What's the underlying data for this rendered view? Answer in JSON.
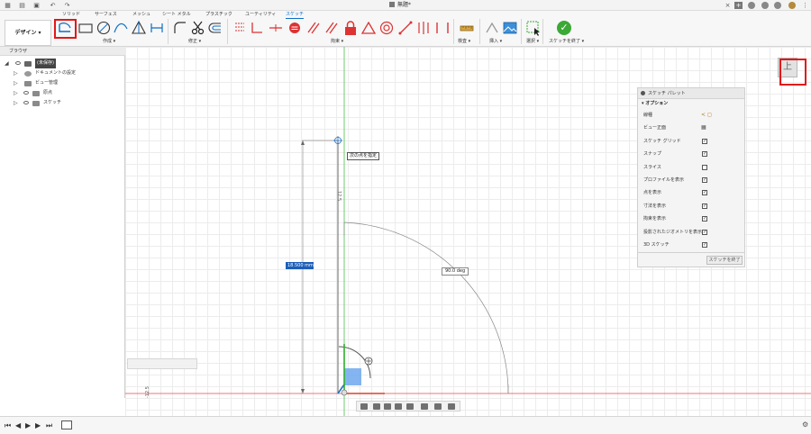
{
  "document": {
    "title": "無題*"
  },
  "ribbon": {
    "workspace": "デザイン ▾",
    "tabs": [
      "ソリッド",
      "サーフェス",
      "メッシュ",
      "シート メタル",
      "プラスチック",
      "ユーティリティ",
      "スケッチ"
    ],
    "active_tab": "スケッチ",
    "groups": {
      "create": "作成 ▾",
      "modify": "修正 ▾",
      "constraints": "拘束 ▾",
      "inspect": "検査 ▾",
      "insert": "挿入 ▾",
      "select": "選択 ▾",
      "finish": "スケッチを終了 ▾"
    }
  },
  "browser": {
    "title": "ブラウザ",
    "root": "(未保存)",
    "items": [
      "ドキュメントの設定",
      "ビュー管理",
      "原点",
      "スケッチ"
    ]
  },
  "canvas": {
    "tooltip": "次の点を指定",
    "length_input": "18.500 mm",
    "angle_label": "90.0 deg",
    "dim_side": "12.5",
    "dim_side_bottom": "-12.5",
    "viewcube_face": "上"
  },
  "palette": {
    "title": "スケッチ パレット",
    "options_header": "オプション",
    "rows": [
      {
        "label": "線種",
        "type": "linetype",
        "checked": null
      },
      {
        "label": "ビュー正面",
        "type": "icon",
        "checked": null
      },
      {
        "label": "スケッチ グリッド",
        "type": "checkbox",
        "checked": true
      },
      {
        "label": "スナップ",
        "type": "checkbox",
        "checked": true
      },
      {
        "label": "スライス",
        "type": "checkbox",
        "checked": false
      },
      {
        "label": "プロファイルを表示",
        "type": "checkbox",
        "checked": true
      },
      {
        "label": "点を表示",
        "type": "checkbox",
        "checked": true
      },
      {
        "label": "寸法を表示",
        "type": "checkbox",
        "checked": true
      },
      {
        "label": "拘束を表示",
        "type": "checkbox",
        "checked": true
      },
      {
        "label": "投影されたジオメトリを表示",
        "type": "checkbox",
        "checked": true
      },
      {
        "label": "3D スケッチ",
        "type": "checkbox",
        "checked": true
      }
    ],
    "finish_button": "スケッチを終了"
  },
  "colors": {
    "accent": "#0b6fc6",
    "highlight": "#e01919",
    "finish_green": "#3aa935",
    "x_axis": "#e54a4a",
    "y_axis": "#4bc14b"
  }
}
